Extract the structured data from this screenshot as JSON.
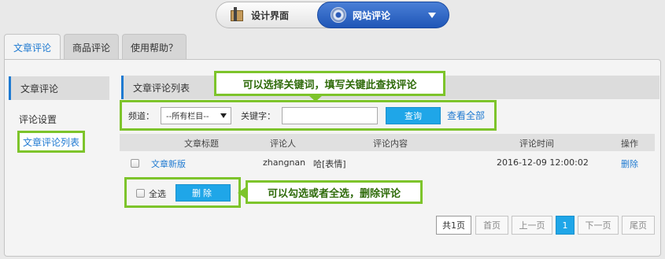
{
  "switcher": {
    "left_label": "设计界面",
    "left_icon": "design-brush-icon",
    "right_label": "网站评论",
    "right_icon": "gear-icon"
  },
  "tabs": [
    {
      "label": "文章评论",
      "active": true
    },
    {
      "label": "商品评论",
      "active": false
    },
    {
      "label": "使用帮助？",
      "active": false
    }
  ],
  "sidebar": {
    "heading": "文章评论",
    "items": [
      {
        "label": "评论设置"
      },
      {
        "label": "文章评论列表",
        "active": true
      }
    ]
  },
  "main": {
    "heading": "文章评论列表"
  },
  "callouts": {
    "filter_tip": "可以选择关键词，填写关键此查找评论",
    "bulk_tip": "可以勾选或者全选，删除评论"
  },
  "filter": {
    "channel_label": "频道：",
    "channel_value": "--所有栏目--",
    "keyword_label": "关键字：",
    "keyword_value": "",
    "search_button": "查询",
    "view_all_link": "查看全部"
  },
  "table": {
    "columns": [
      "文章标题",
      "评论人",
      "评论内容",
      "评论时间",
      "操作"
    ],
    "rows": [
      {
        "title": "文章新版",
        "author": "zhangnan",
        "content": "哈[表情]",
        "time": "2016-12-09 12:00:02",
        "action": "删除"
      }
    ]
  },
  "bulk": {
    "select_all_label": "全选",
    "delete_button": "删除"
  },
  "pagination": {
    "total": "共1页",
    "first": "首页",
    "prev": "上一页",
    "current": "1",
    "next": "下一页",
    "last": "尾页"
  },
  "colors": {
    "accent_blue": "#1f7ad1",
    "button_blue": "#1fa6e8",
    "highlight_green": "#7dc42b",
    "switch_blue": "#2a5ab8"
  }
}
